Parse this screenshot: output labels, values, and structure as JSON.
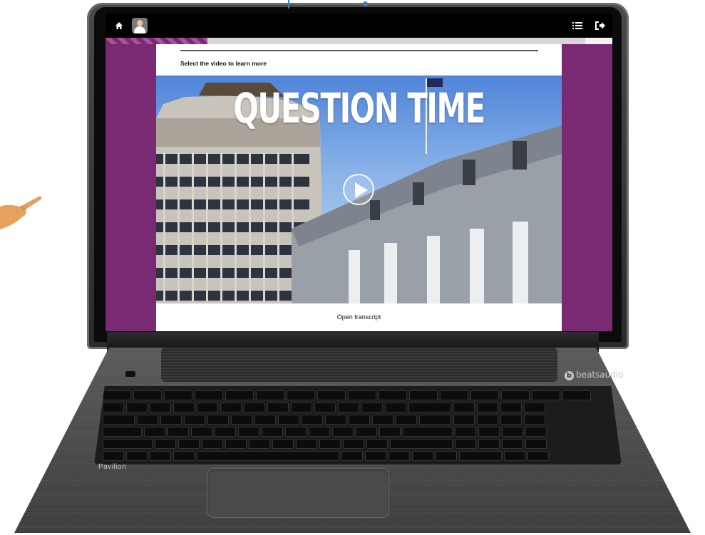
{
  "screen": {
    "instruction": "Select the video to learn more",
    "video": {
      "title": "QUESTION TIME"
    },
    "transcript_label": "Open transcript"
  },
  "laptop": {
    "model_label": "Pavilion",
    "audio_brand": "beatsaudio"
  },
  "icons": {
    "home": "home-icon",
    "avatar": "user-avatar",
    "menu": "list-icon",
    "exit": "exit-icon",
    "play": "play-icon",
    "pointer": "pointing-hand-icon"
  },
  "colors": {
    "accent_purple": "#7a2a72",
    "topbar": "#000000",
    "content_bg": "#ffffff"
  }
}
